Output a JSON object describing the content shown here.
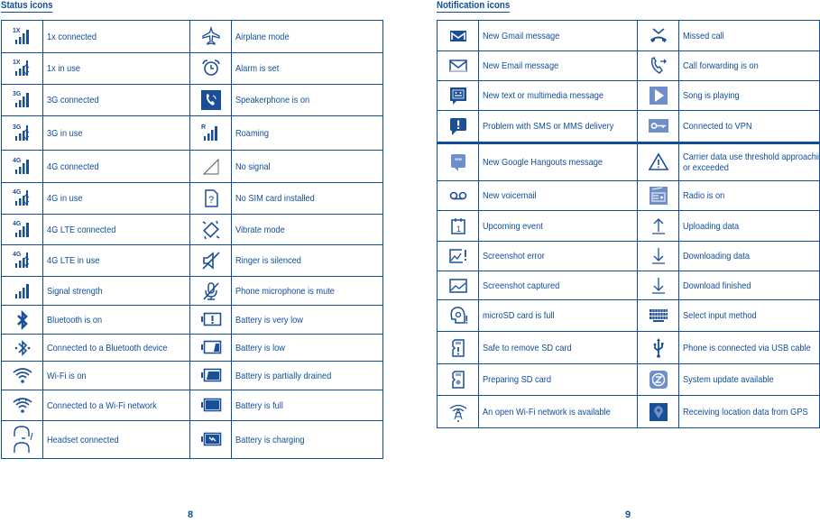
{
  "status": {
    "title": "Status icons",
    "rows": [
      {
        "l_icon": "1x-signal-icon",
        "l_label": "1x connected",
        "r_icon": "airplane-icon",
        "r_label": "Airplane mode"
      },
      {
        "l_icon": "1x-in-use-icon",
        "l_label": "1x in use",
        "r_icon": "alarm-icon",
        "r_label": "Alarm is set"
      },
      {
        "l_icon": "3g-signal-icon",
        "l_label": "3G connected",
        "r_icon": "speakerphone-icon",
        "r_label": "Speakerphone is on"
      },
      {
        "l_icon": "3g-in-use-icon",
        "l_label": "3G in use",
        "r_icon": "roaming-icon",
        "r_label": "Roaming"
      },
      {
        "l_icon": "4g-signal-icon",
        "l_label": "4G connected",
        "r_icon": "no-signal-icon",
        "r_label": "No signal"
      },
      {
        "l_icon": "4g-in-use-icon",
        "l_label": "4G in use",
        "r_icon": "no-sim-icon",
        "r_label": "No SIM card installed"
      },
      {
        "l_icon": "4g-lte-signal-icon",
        "l_label": "4G LTE connected",
        "r_icon": "vibrate-icon",
        "r_label": "Vibrate mode"
      },
      {
        "l_icon": "4g-lte-in-use-icon",
        "l_label": "4G LTE in use",
        "r_icon": "ringer-silenced-icon",
        "r_label": "Ringer is silenced"
      },
      {
        "l_icon": "signal-strength-icon",
        "l_label": "Signal strength",
        "r_icon": "mic-mute-icon",
        "r_label": "Phone microphone is mute"
      },
      {
        "l_icon": "bluetooth-icon",
        "l_label": "Bluetooth is on",
        "r_icon": "battery-very-low-icon",
        "r_label": "Battery is very low"
      },
      {
        "l_icon": "bluetooth-connected-icon",
        "l_label": "Connected to a Bluetooth device",
        "r_icon": "battery-low-icon",
        "r_label": "Battery is low"
      },
      {
        "l_icon": "wifi-icon",
        "l_label": "Wi-Fi is on",
        "r_icon": "battery-partial-icon",
        "r_label": "Battery is partially drained"
      },
      {
        "l_icon": "wifi-connected-icon",
        "l_label": "Connected to a Wi-Fi network",
        "r_icon": "battery-full-icon",
        "r_label": "Battery is full"
      },
      {
        "l_icon": "headset-icon",
        "l_label": "Headset connected",
        "r_icon": "battery-charging-icon",
        "r_label": "Battery is charging"
      }
    ],
    "page_number": "8"
  },
  "notification": {
    "title": "Notification icons",
    "rows": [
      {
        "l_icon": "gmail-icon",
        "l_label": "New Gmail message",
        "r_icon": "missed-call-icon",
        "r_label": "Missed call"
      },
      {
        "l_icon": "email-icon",
        "l_label": "New Email message",
        "r_icon": "call-forwarding-icon",
        "r_label": "Call forwarding is on"
      },
      {
        "l_icon": "message-icon",
        "l_label": "New text or multimedia message",
        "r_icon": "song-playing-icon",
        "r_label": "Song is playing"
      },
      {
        "l_icon": "sms-problem-icon",
        "l_label": "Problem with SMS or MMS delivery",
        "r_icon": "vpn-key-icon",
        "r_label": "Connected to VPN"
      },
      {
        "l_icon": "hangouts-icon",
        "l_label": "New Google Hangouts message",
        "r_icon": "warning-icon",
        "r_label": "Carrier data use threshold approaching or exceeded"
      },
      {
        "l_icon": "voicemail-icon",
        "l_label": "New voicemail",
        "r_icon": "radio-icon",
        "r_label": "Radio is on"
      },
      {
        "l_icon": "calendar-icon",
        "l_label": "Upcoming event",
        "r_icon": "upload-icon",
        "r_label": "Uploading data"
      },
      {
        "l_icon": "screenshot-error-icon",
        "l_label": "Screenshot error",
        "r_icon": "download-icon",
        "r_label": "Downloading data"
      },
      {
        "l_icon": "screenshot-icon",
        "l_label": " Screenshot captured",
        "r_icon": "download-finished-icon",
        "r_label": "Download finished"
      },
      {
        "l_icon": "sd-full-icon",
        "l_label": "microSD card is full",
        "r_icon": "keyboard-icon",
        "r_label": "Select input method"
      },
      {
        "l_icon": "sd-remove-icon",
        "l_label": "Safe to remove SD card",
        "r_icon": "usb-icon",
        "r_label": "Phone is connected via USB cable"
      },
      {
        "l_icon": "sd-preparing-icon",
        "l_label": "Preparing SD card",
        "r_icon": "system-update-icon",
        "r_label": "System update available"
      },
      {
        "l_icon": "open-wifi-icon",
        "l_label": "An open Wi-Fi network is available",
        "r_icon": "gps-icon",
        "r_label": "Receiving location data from GPS"
      }
    ],
    "page_number": "9"
  },
  "colors": {
    "primary": "#0f4e96",
    "icon_fill": "#1a4f97",
    "icon_light": "#6e8fca"
  }
}
